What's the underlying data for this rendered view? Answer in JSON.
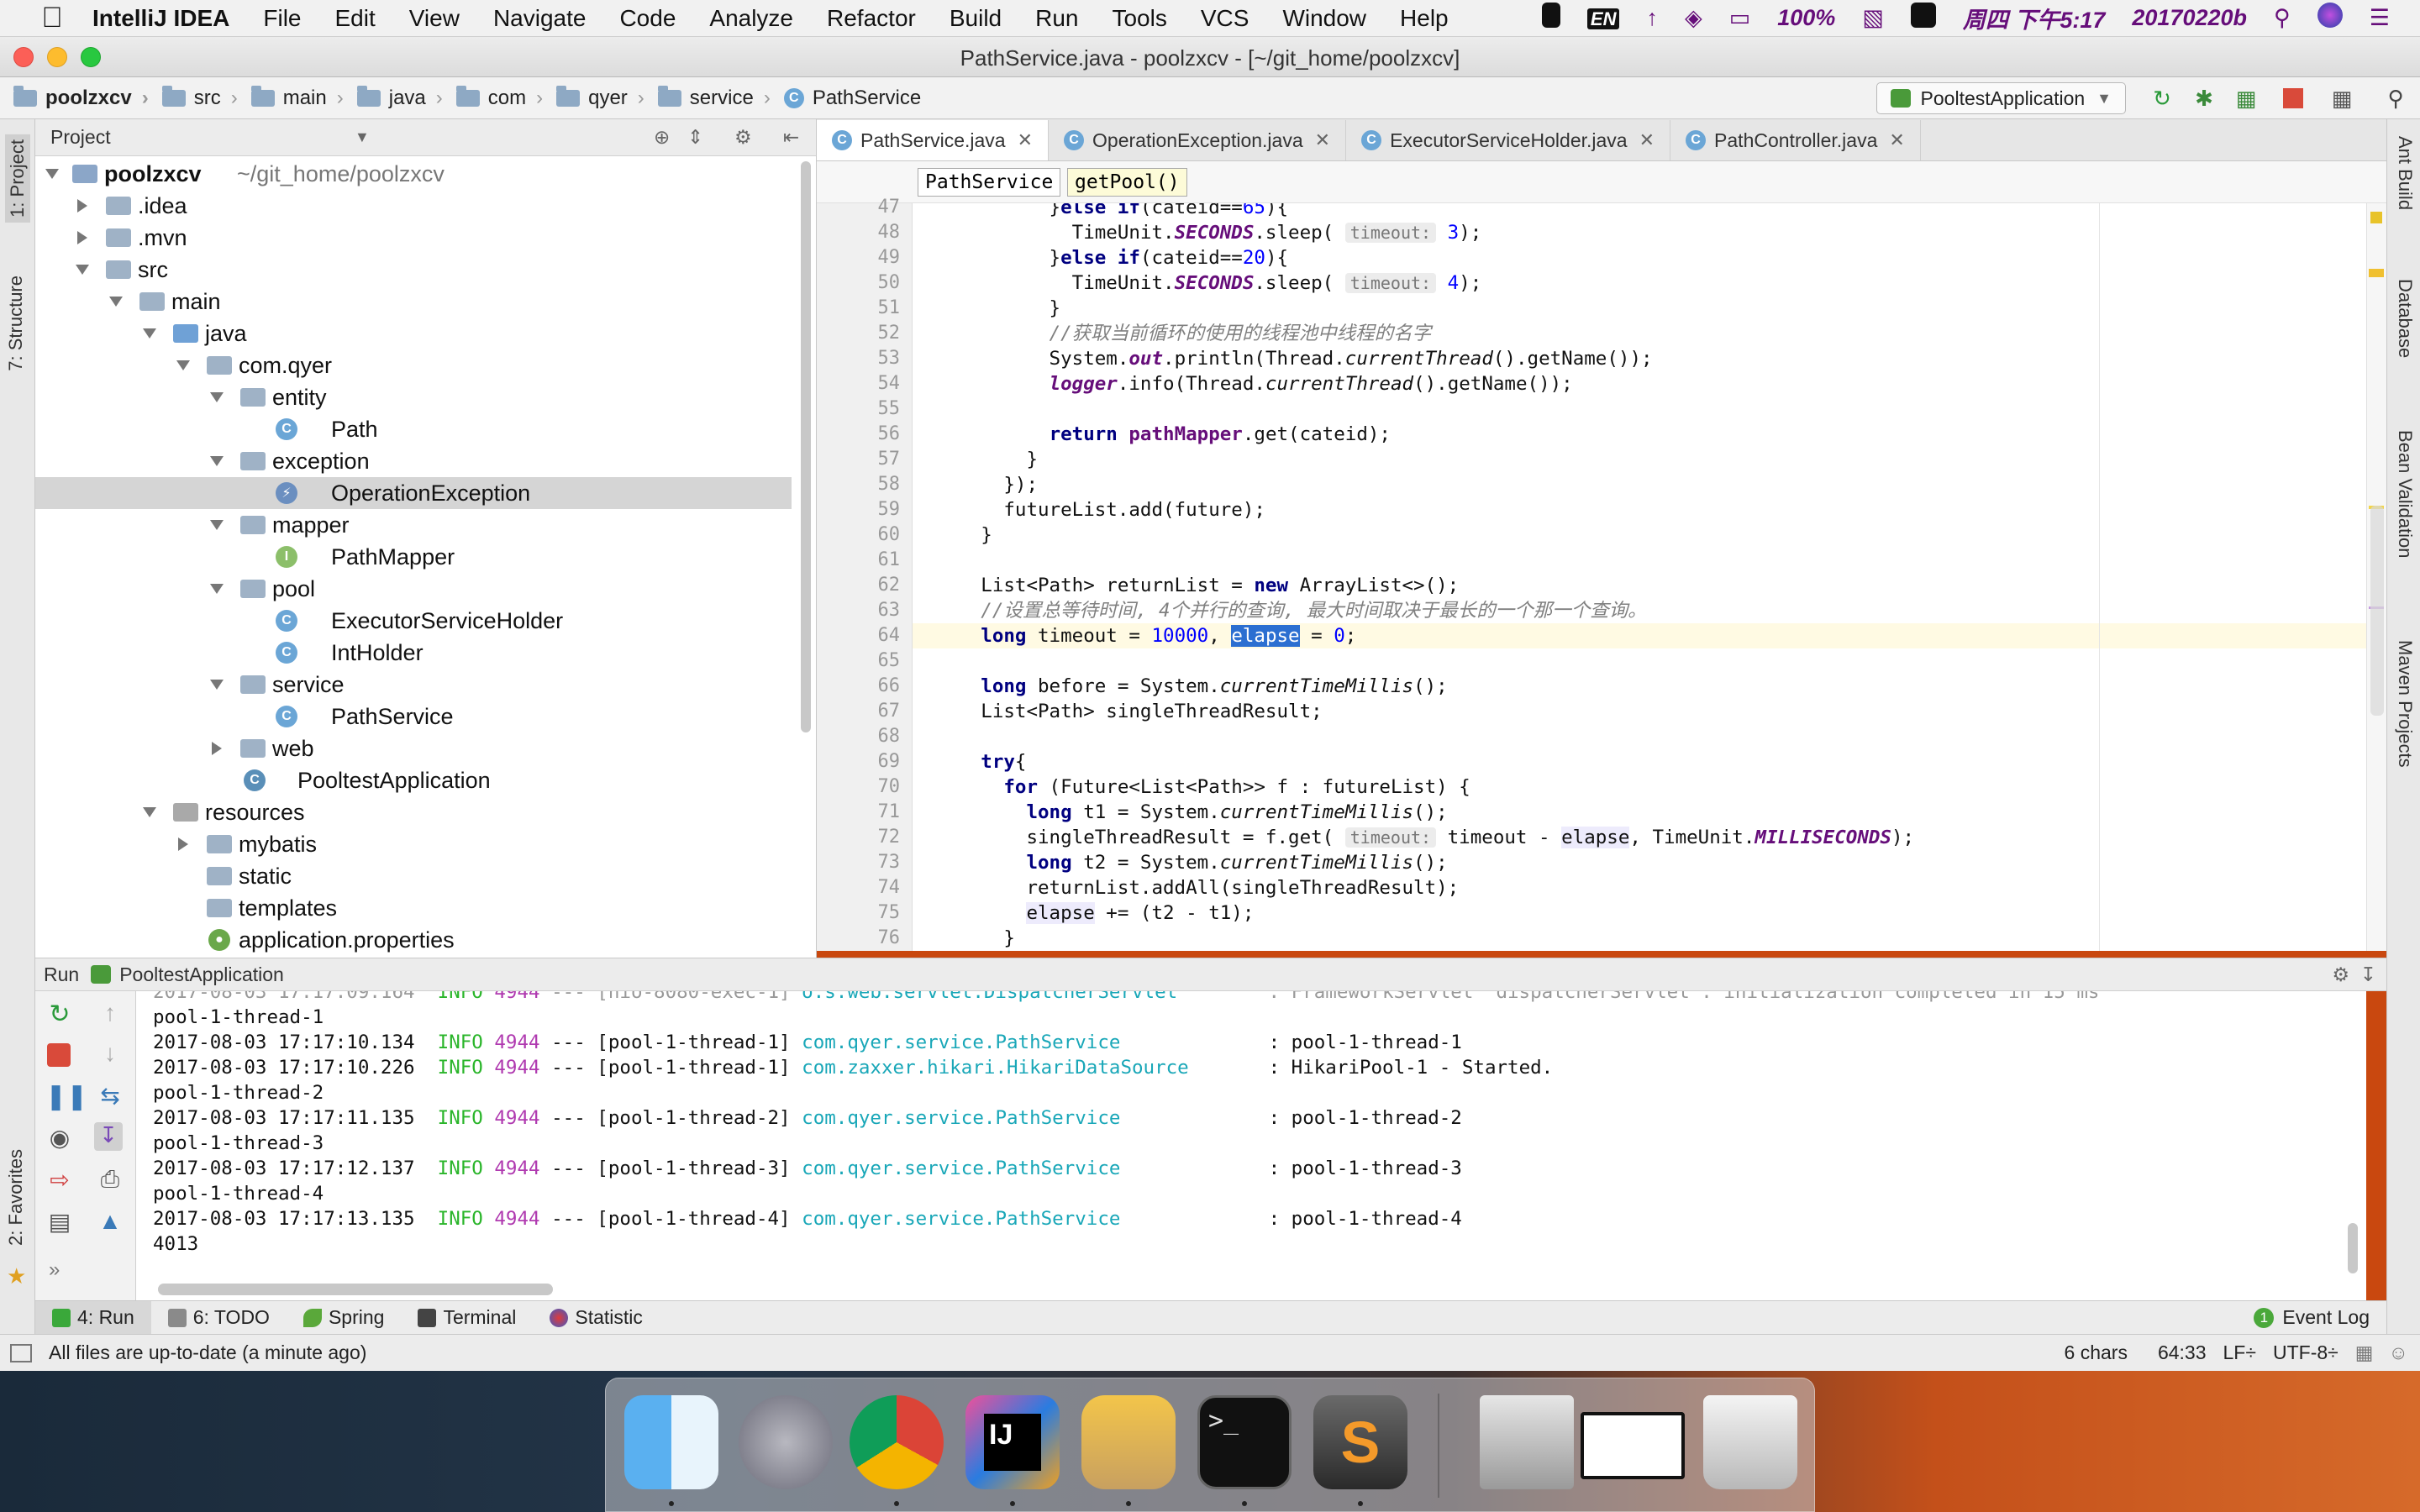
{
  "menubar": {
    "app_name": "IntelliJ IDEA",
    "items": [
      "File",
      "Edit",
      "View",
      "Navigate",
      "Code",
      "Analyze",
      "Refactor",
      "Build",
      "Run",
      "Tools",
      "VCS",
      "Window",
      "Help"
    ],
    "status": {
      "input": "EN",
      "battery": "100%",
      "datetime": "周四 下午5:17",
      "user": "20170220b"
    }
  },
  "window": {
    "title": "PathService.java - poolzxcv - [~/git_home/poolzxcv]"
  },
  "navbar": {
    "crumbs": [
      "poolzxcv",
      "src",
      "main",
      "java",
      "com",
      "qyer",
      "service",
      "PathService"
    ],
    "run_config": "PooltestApplication"
  },
  "leftstrip": {
    "project_tab": "1: Project",
    "structure_tab": "7: Structure",
    "favorites_tab": "2: Favorites"
  },
  "project": {
    "header": "Project",
    "root_label": "poolzxcv",
    "root_path": "~/git_home/poolzxcv",
    "tree": [
      {
        "label": ".idea"
      },
      {
        "label": ".mvn"
      },
      {
        "label": "src"
      },
      {
        "label": "main"
      },
      {
        "label": "java"
      },
      {
        "label": "com.qyer"
      },
      {
        "label": "entity"
      },
      {
        "label": "Path"
      },
      {
        "label": "exception"
      },
      {
        "label": "OperationException"
      },
      {
        "label": "mapper"
      },
      {
        "label": "PathMapper"
      },
      {
        "label": "pool"
      },
      {
        "label": "ExecutorServiceHolder"
      },
      {
        "label": "IntHolder"
      },
      {
        "label": "service"
      },
      {
        "label": "PathService"
      },
      {
        "label": "web"
      },
      {
        "label": "PooltestApplication"
      },
      {
        "label": "resources"
      },
      {
        "label": "mybatis"
      },
      {
        "label": "static"
      },
      {
        "label": "templates"
      },
      {
        "label": "application.properties"
      }
    ]
  },
  "editor": {
    "tabs": [
      "PathService.java",
      "OperationException.java",
      "ExecutorServiceHolder.java",
      "PathController.java"
    ],
    "breadcrumb": [
      "PathService",
      "getPool()"
    ],
    "line_numbers": [
      "47",
      "48",
      "49",
      "50",
      "51",
      "52",
      "53",
      "54",
      "55",
      "56",
      "57",
      "58",
      "59",
      "60",
      "61",
      "62",
      "63",
      "64",
      "65",
      "66",
      "67",
      "68",
      "69",
      "70",
      "71",
      "72",
      "73",
      "74",
      "75",
      "76"
    ],
    "comment_52": "//获取当前循环的使用的线程池中线程的名字",
    "comment_63": "//设置总等待时间, 4个并行的查询, 最大时间取决于最长的一个那一个查询。",
    "hint_timeout": "timeout:"
  },
  "rightstrip": {
    "tabs": [
      "Ant Build",
      "Database",
      "Bean Validation",
      "Maven Projects"
    ]
  },
  "run": {
    "header_label": "Run",
    "config": "PooltestApplication",
    "console": [
      {
        "plain": "pool-1-thread-1"
      },
      {
        "ts": "2017-08-03 17:17:10.134",
        "level": "INFO",
        "pid": "4944",
        "thread": "--- [pool-1-thread-1]",
        "cls": "com.qyer.service.PathService",
        "msg": ": pool-1-thread-1"
      },
      {
        "ts": "2017-08-03 17:17:10.226",
        "level": "INFO",
        "pid": "4944",
        "thread": "--- [pool-1-thread-1]",
        "cls": "com.zaxxer.hikari.HikariDataSource",
        "msg": ": HikariPool-1 - Started."
      },
      {
        "plain": "pool-1-thread-2"
      },
      {
        "ts": "2017-08-03 17:17:11.135",
        "level": "INFO",
        "pid": "4944",
        "thread": "--- [pool-1-thread-2]",
        "cls": "com.qyer.service.PathService",
        "msg": ": pool-1-thread-2"
      },
      {
        "plain": "pool-1-thread-3"
      },
      {
        "ts": "2017-08-03 17:17:12.137",
        "level": "INFO",
        "pid": "4944",
        "thread": "--- [pool-1-thread-3]",
        "cls": "com.qyer.service.PathService",
        "msg": ": pool-1-thread-3"
      },
      {
        "plain": "pool-1-thread-4"
      },
      {
        "ts": "2017-08-03 17:17:13.135",
        "level": "INFO",
        "pid": "4944",
        "thread": "--- [pool-1-thread-4]",
        "cls": "com.qyer.service.PathService",
        "msg": ": pool-1-thread-4"
      },
      {
        "plain": "4013"
      }
    ]
  },
  "tooltabs": [
    "4: Run",
    "6: TODO",
    "Spring",
    "Terminal",
    "Statistic"
  ],
  "event_log": {
    "count": "1",
    "label": "Event Log"
  },
  "statusbar": {
    "message": "All files are up-to-date (a minute ago)",
    "chars": "6 chars",
    "position": "64:33",
    "line_sep": "LF÷",
    "encoding": "UTF-8÷"
  },
  "colors": {
    "accent": "#2c6fd1",
    "keyword": "#000080",
    "number": "#0000ff",
    "info": "#2ab52a",
    "class_link": "#19a7b8"
  }
}
